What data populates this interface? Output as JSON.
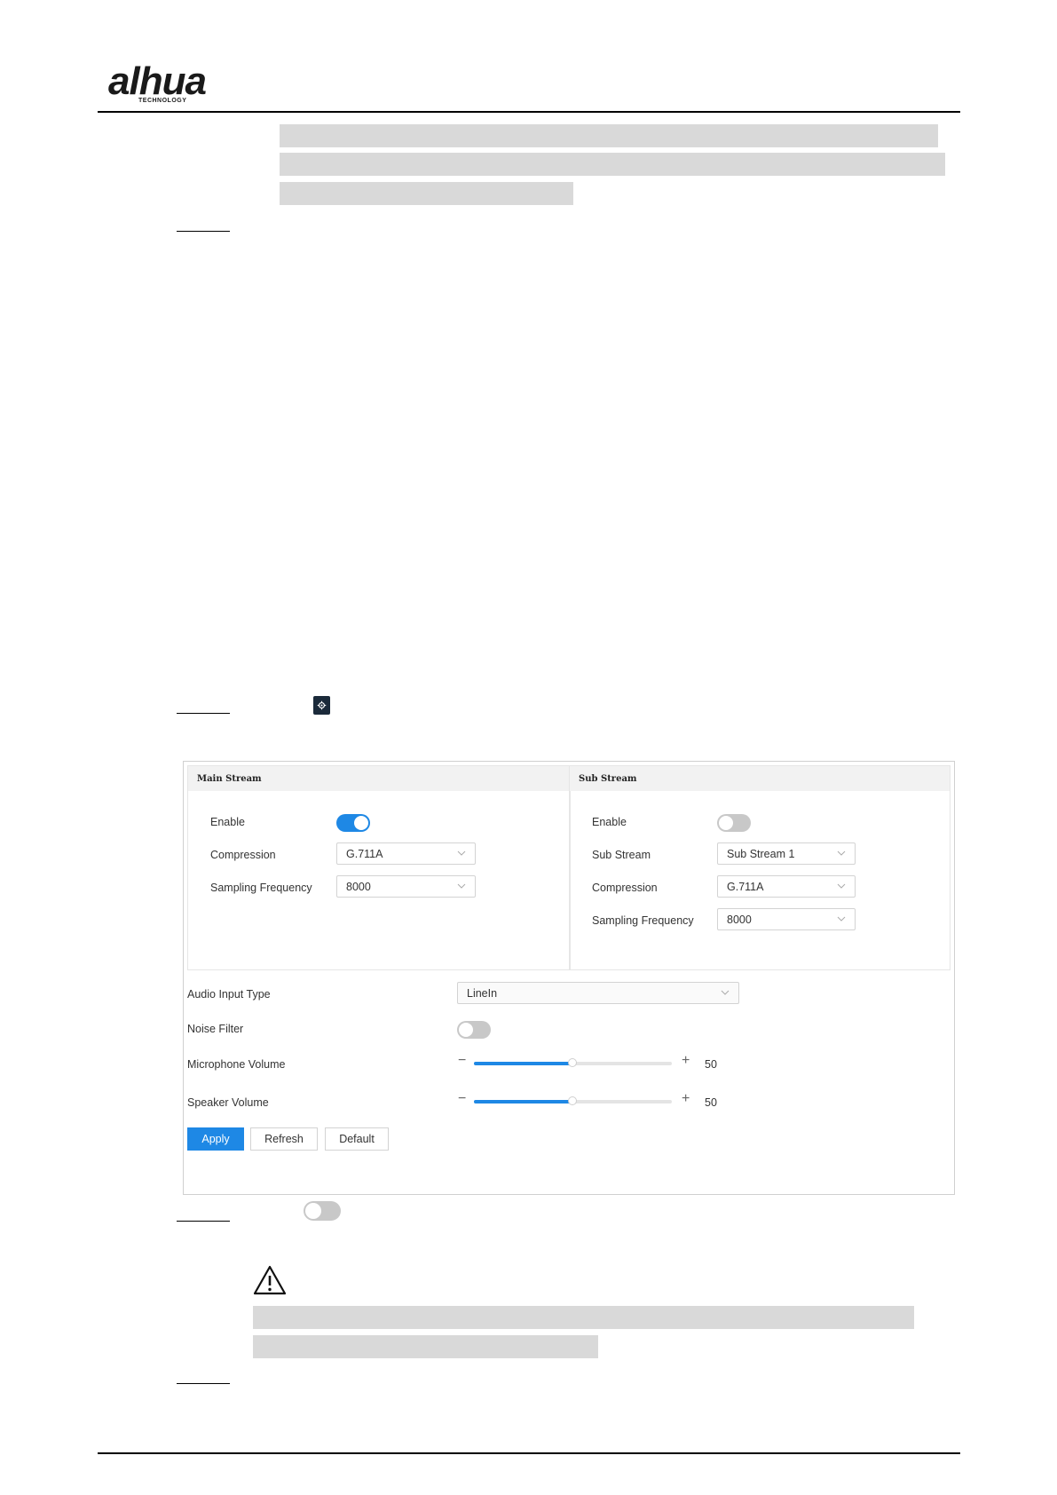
{
  "header": {
    "logo_text": "alhua",
    "logo_subtext": "TECHNOLOGY"
  },
  "panel": {
    "main_stream": {
      "title": "Main Stream",
      "enable_label": "Enable",
      "enable_on": true,
      "compression_label": "Compression",
      "compression_value": "G.711A",
      "sampling_label": "Sampling Frequency",
      "sampling_value": "8000"
    },
    "sub_stream": {
      "title": "Sub Stream",
      "enable_label": "Enable",
      "enable_on": false,
      "substream_label": "Sub Stream",
      "substream_value": "Sub Stream 1",
      "compression_label": "Compression",
      "compression_value": "G.711A",
      "sampling_label": "Sampling Frequency",
      "sampling_value": "8000"
    },
    "audio_input_label": "Audio Input   Type",
    "audio_input_value": "LineIn",
    "noise_filter_label": "Noise Filter",
    "noise_filter_on": false,
    "mic_volume_label": "Microphone Volume",
    "mic_volume_value": "50",
    "speaker_volume_label": "Speaker Volume",
    "speaker_volume_value": "50",
    "minus_symbol": "−",
    "plus_symbol": "+",
    "buttons": {
      "apply": "Apply",
      "refresh": "Refresh",
      "default": "Default"
    }
  },
  "colors": {
    "accent": "#1e88e5",
    "redaction": "#d9d9d9",
    "toggle_off": "#c8c8c8"
  },
  "icons": {
    "gear": "gear-icon",
    "warning": "warning-icon",
    "chevron": "chevron-down-icon"
  }
}
